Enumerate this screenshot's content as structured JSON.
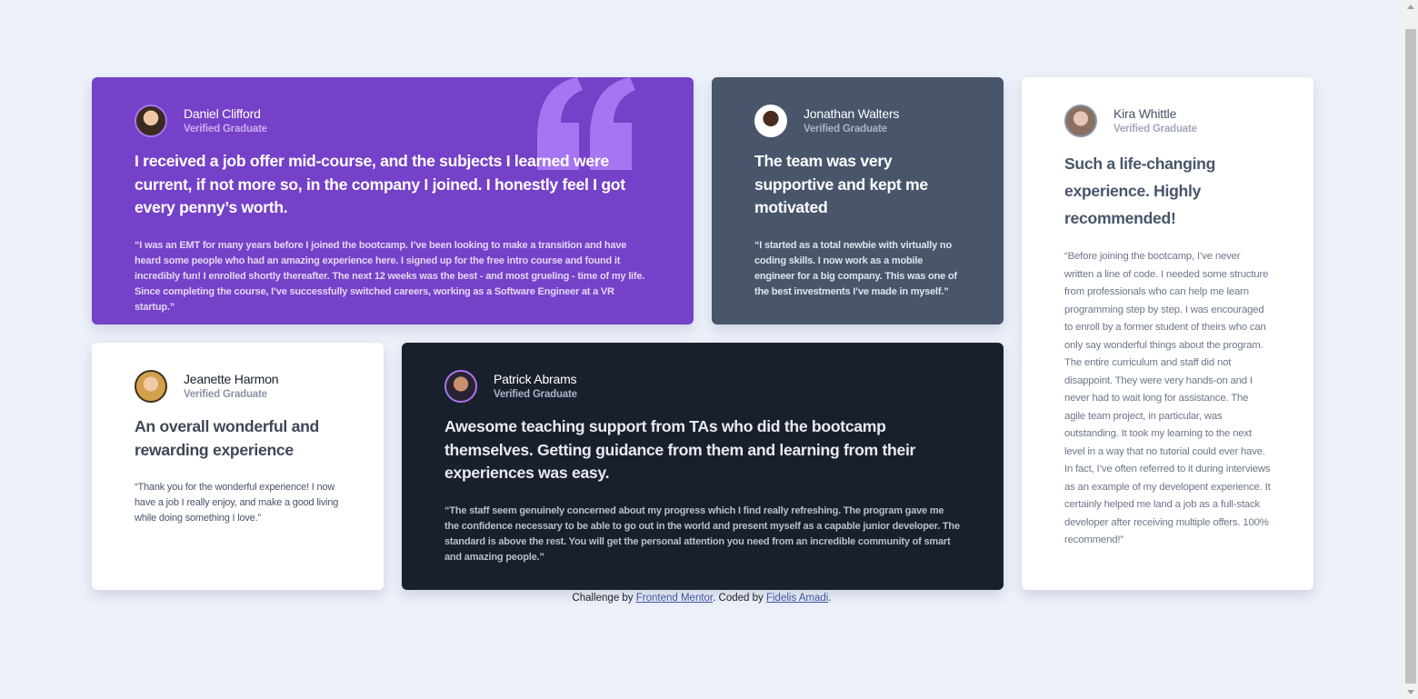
{
  "page": {
    "background": "#ecf1fa"
  },
  "testimonials": [
    {
      "name": "Daniel Clifford",
      "role": "Verified Graduate",
      "headline": "I received a job offer mid-course, and the subjects I learned were current, if not more so, in the company I joined. I honestly feel I got every penny’s worth.",
      "body": "“I was an EMT for many years before I joined the bootcamp. I’ve been looking to make a transition and have heard some people who had an amazing experience here. I signed up for the free intro course and found it incredibly fun! I enrolled shortly thereafter. The next 12 weeks was the best - and most grueling - time of my life. Since completing the course, I’ve successfully switched careers, working as a Software Engineer at a VR startup.”",
      "color": "#7541c8"
    },
    {
      "name": "Jonathan Walters",
      "role": "Verified Graduate",
      "headline": "The team was very supportive and kept me motivated",
      "body": "“I started as a total newbie with virtually no coding skills. I now work as a mobile engineer for a big company. This was one of the best investments I’ve made in myself.”",
      "color": "#48556a"
    },
    {
      "name": "Kira Whittle",
      "role": "Verified Graduate",
      "headline": "Such a life-changing experience. Highly recommended!",
      "body": "“Before joining the bootcamp, I’ve never written a line of code. I needed some structure from professionals who can help me learn programming step by step. I was encouraged to enroll by a former student of theirs who can only say wonderful things about the program. The entire curriculum and staff did not disappoint. They were very hands-on and I never had to wait long for assistance. The agile team project, in particular, was outstanding. It took my learning to the next level in a way that no tutorial could ever have. In fact, I’ve often referred to it during interviews as an example of my developent experience. It certainly helped me land a job as a full-stack developer after receiving multiple offers. 100% recommend!”",
      "color": "#ffffff"
    },
    {
      "name": "Jeanette Harmon",
      "role": "Verified Graduate",
      "headline": "An overall wonderful and rewarding experience",
      "body": "“Thank you for the wonderful experience! I now have a job I really enjoy, and make a good living while doing something I love.”",
      "color": "#ffffff"
    },
    {
      "name": "Patrick Abrams",
      "role": "Verified Graduate",
      "headline": "Awesome teaching support from TAs who did the bootcamp themselves. Getting guidance from them and learning from their experiences was easy.",
      "body": "“The staff seem genuinely concerned about my progress which I find really refreshing. The program gave me the confidence necessary to be able to go out in the world and present myself as a capable junior developer. The standard is above the rest. You will get the personal attention you need from an incredible community of smart and amazing people.”",
      "color": "#19202d"
    }
  ],
  "quote_icon": "quotation-mark-icon",
  "footer": {
    "prefix": "Challenge by ",
    "link1": "Frontend Mentor",
    "middle": ". Coded by ",
    "link2": "Fidelis Amadi",
    "suffix": "."
  }
}
